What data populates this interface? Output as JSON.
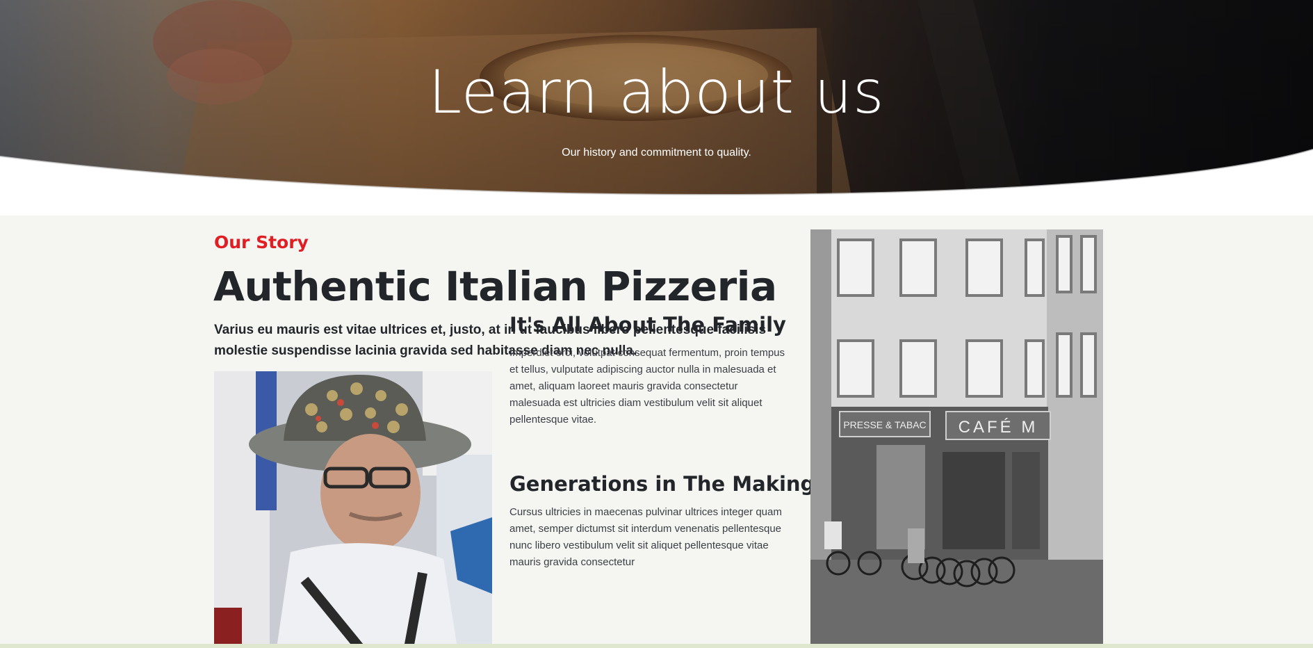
{
  "hero": {
    "title": "Learn about us",
    "subtitle": "Our history and commitment to quality."
  },
  "story": {
    "eyebrow": "Our Story",
    "headline": "Authentic Italian Pizzeria",
    "lead": "Varius eu mauris est vitae ultrices et, justo, at in ut faucibus libero pellentesque facilisis molestie suspendisse lacinia gravida sed habitasse diam nec nulla.",
    "blocks": [
      {
        "heading": "It's All About The Family",
        "body": "Imperdiet orci, volutpat consequat fermentum, proin tempus et tellus, vulputate adipiscing auctor nulla in malesuada et amet, aliquam laoreet mauris gravida consectetur malesuada est ultricies diam vestibulum velit sit aliquet pellentesque vitae."
      },
      {
        "heading": "Generations in The Making",
        "body": "Cursus ultricies in maecenas pulvinar ultrices integer quam amet, semper dictumst sit interdum venenatis pellentesque nunc libero vestibulum velit sit aliquet pellentesque vitae mauris gravida consectetur"
      }
    ],
    "cafe_sign": "CAFÉ M",
    "shop_sign": "PRESSE & TABAC"
  },
  "colors": {
    "accent": "#e01e24",
    "heading": "#22252a",
    "section_bg": "#f5f5f1"
  }
}
